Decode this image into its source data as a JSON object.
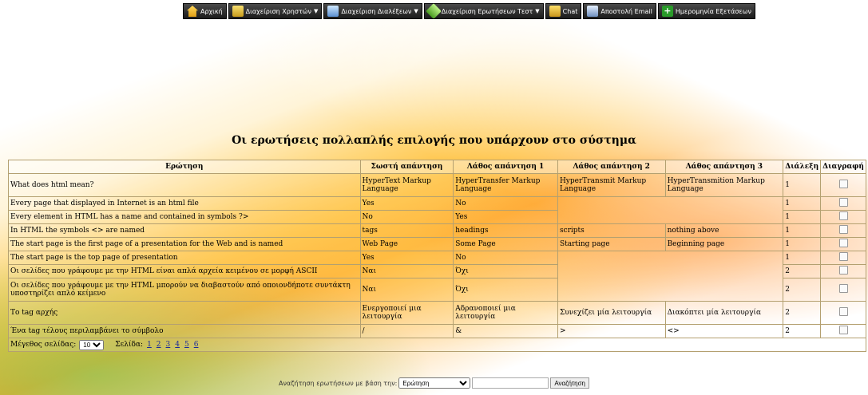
{
  "menu": [
    {
      "label": "Αρχική",
      "icon": "home-icon",
      "dropdown": false
    },
    {
      "label": "Διαχείριση Χρηστών",
      "icon": "users-icon",
      "dropdown": true
    },
    {
      "label": "Διαχείριση Διαλέξεων",
      "icon": "lectures-icon",
      "dropdown": true
    },
    {
      "label": "Διαχείριση Ερωτήσεων Τεστ",
      "icon": "quiz-pencil-icon",
      "dropdown": true
    },
    {
      "label": "Chat",
      "icon": "chat-icon",
      "dropdown": false
    },
    {
      "label": "Αποστολή Email",
      "icon": "email-icon",
      "dropdown": false
    },
    {
      "label": "Ημερομηνία Εξετάσεων",
      "icon": "add-date-icon",
      "dropdown": false
    }
  ],
  "page_title": "Οι ερωτήσεις πολλαπλής επιλογής που υπάρχουν στο σύστημα",
  "table": {
    "headers": [
      "Ερώτηση",
      "Σωστή απάντηση",
      "Λάθος απάντηση 1",
      "Λάθος απάντηση 2",
      "Λάθος απάντηση 3",
      "Διάλεξη",
      "Διαγραφή"
    ],
    "rows": [
      [
        "What does html mean?",
        "HyperText Markup Language",
        "HyperTransfer Markup Language",
        "HyperTransmit Markup Language",
        "HyperTransmition Markup Language",
        "1"
      ],
      [
        "Every page that displayed in Internet is an html file",
        "Yes",
        "No",
        "",
        "",
        "1"
      ],
      [
        "Every element in HTML has a name and contained in symbols ?>",
        "No",
        "Yes",
        "",
        "",
        "1"
      ],
      [
        "In HTML the symbols <> are named",
        "tags",
        "headings",
        "scripts",
        "nothing above",
        "1"
      ],
      [
        "The start page is the first page of a presentation for the Web and is named",
        "Web Page",
        "Some Page",
        "Starting page",
        "Beginning page",
        "1"
      ],
      [
        "The start page is the top page of presentation",
        "Yes",
        "No",
        "",
        "",
        "1"
      ],
      [
        "Οι σελίδες που γράφουμε με την HTML είναι απλά αρχεία κειμένου σε μορφή ASCII",
        "Ναι",
        "Όχι",
        "",
        "",
        "2"
      ],
      [
        "Οι σελίδες που γράφουμε με την HTML μπορούν να διαβαστούν από οποιονδήποτε συντάκτη υποστηρίζει απλό κείμενο",
        "Ναι",
        "Όχι",
        "",
        "",
        "2"
      ],
      [
        "Το tag αρχής",
        "Ενεργοποιεί μια λειτουργία",
        "Αδρανοποιεί μια λειτουργία",
        "Συνεχίζει μία λειτουργία",
        "Διακόπτει μία λειτουργία",
        "2"
      ],
      [
        "Ένα tag τέλους περιλαμβάνει το σύμβολο",
        "/",
        "&",
        ">",
        "<>",
        "2"
      ]
    ]
  },
  "pager": {
    "page_size_label": "Μέγεθος σελίδας:",
    "page_size": "10",
    "page_label": "Σελίδα:",
    "pages": [
      "1",
      "2",
      "3",
      "4",
      "5",
      "6"
    ]
  },
  "search": {
    "label": "Αναζήτηση ερωτήσεων με βάση την:",
    "field": "Ερώτηση",
    "button": "Αναζήτηση"
  }
}
